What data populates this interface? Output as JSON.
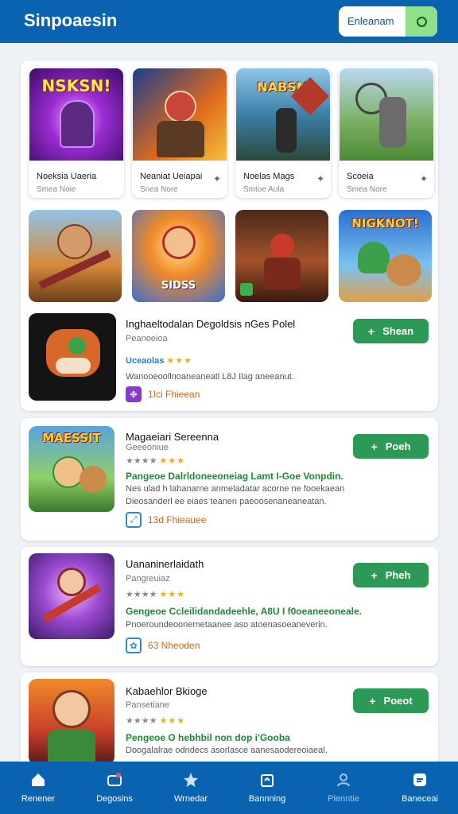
{
  "header": {
    "title": "Sinpoaesin",
    "search_text": "Enleanam"
  },
  "featured": [
    {
      "name": "Noeksia Uaeria",
      "sub": "Smea Noie",
      "art_text": "NSKSN!"
    },
    {
      "name": "Neaniat Ueiapai",
      "sub": "Snea Nore",
      "art_text": ""
    },
    {
      "name": "Noelas Mags",
      "sub": "Smtoe Aula",
      "art_text": "NABSM"
    },
    {
      "name": "Scoeia",
      "sub": "Smea Nore",
      "art_text": ""
    }
  ],
  "art_row": [
    {
      "art_text": ""
    },
    {
      "art_text": "SIDSS"
    },
    {
      "art_text": ""
    },
    {
      "art_text": "NIGKNOT!"
    }
  ],
  "list": [
    {
      "title": "Inghaeltodalan Degoldsis nGes Polel",
      "developer": "Peanoeioa",
      "rating_label": "Uceaolas",
      "stars": "★★★",
      "desc": "Wanooeoollnoaneaneatl L8J Ilag aneeanut.",
      "meta": "1Ici Fhieean",
      "action": "Shean"
    },
    {
      "title": "Magaeiari Sereenna",
      "developer": "Geeeoniue",
      "stars_gray": "★★★★",
      "stars": "★★★",
      "green": "Pangeoe Dalrldoneeoneiag Lamt I-Goe Vonpdin.",
      "desc": "Nes ulad h lahanarne anmeladatar acorne ne fooekaean",
      "desc2": "Dieosanderl ee eiaes teanen paeoosenaneaneatan.",
      "meta": "13d Fhieauee",
      "action": "Poeh"
    },
    {
      "title": "Uananinerlaidath",
      "developer": "Pangreuiaz",
      "stars_gray": "★★★★",
      "stars": "★★★",
      "green": "Gengeoe Ccleilidandadeehle, A8U I f0oeaneeoneale.",
      "desc": "Pnoeroundeoonemetaanee aso atoenasoeaneverin.",
      "meta": "63 Nheoden",
      "action": "Pheh"
    },
    {
      "title": "Kabaehlor Bkioge",
      "developer": "Pansetiane",
      "stars_gray": "★★★★",
      "stars": "★★★",
      "green": "Pengeoe O hebhbil non dop i'Gooba",
      "desc": "Doogalalrae odndecs asorlasce aanesaodereoiaeal.",
      "action": "Poeot"
    }
  ],
  "nav": [
    {
      "label": "Renener"
    },
    {
      "label": "Degosins"
    },
    {
      "label": "Wrnedar"
    },
    {
      "label": "Bannning"
    },
    {
      "label": "Plenntie"
    },
    {
      "label": "Baneceai"
    }
  ],
  "colors": {
    "brand": "#0a63b0",
    "accent": "#2c9a56",
    "search_button": "#8fe08a"
  }
}
